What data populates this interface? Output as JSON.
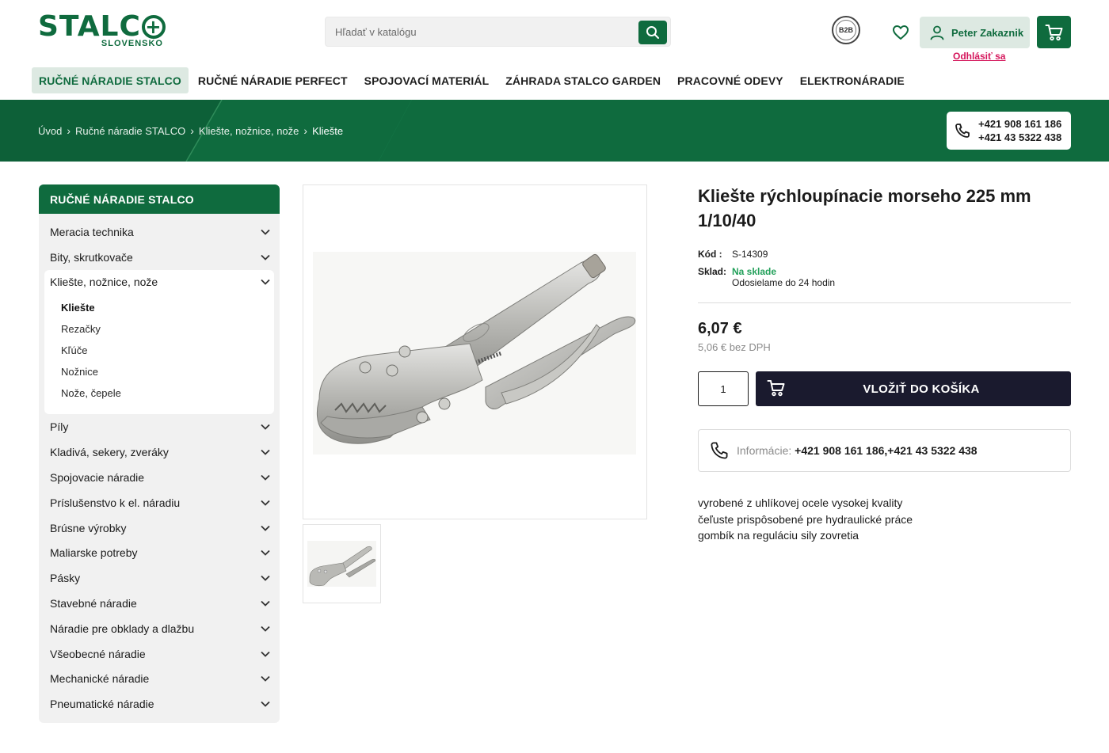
{
  "header": {
    "logo_text": "STALC",
    "logo_plus": "+",
    "logo_sub": "SLOVENSKO",
    "search_placeholder": "Hľadať v katalógu",
    "b2b_label": "B2B",
    "user_name": "Peter Zakaznik",
    "logout_label": "Odhlásiť sa"
  },
  "nav": [
    {
      "label": "RUČNÉ NÁRADIE STALCO",
      "active": true
    },
    {
      "label": "RUČNÉ NÁRADIE PERFECT",
      "active": false
    },
    {
      "label": "SPOJOVACÍ MATERIÁL",
      "active": false
    },
    {
      "label": "ZÁHRADA STALCO GARDEN",
      "active": false
    },
    {
      "label": "PRACOVNÉ ODEVY",
      "active": false
    },
    {
      "label": "ELEKTRONÁRADIE",
      "active": false
    }
  ],
  "breadcrumb": [
    "Úvod",
    "Ručné náradie STALCO",
    "Kliešte, nožnice, nože",
    "Kliešte"
  ],
  "contact_phones": [
    "+421 908 161 186",
    "+421 43 5322 438"
  ],
  "sidebar": {
    "title": "RUČNÉ NÁRADIE STALCO",
    "categories": [
      "Meracia technika",
      "Bity, skrutkovače",
      "Kliešte, nožnice, nože",
      "Píly",
      "Kladivá, sekery, zveráky",
      "Spojovacie náradie",
      "Príslušenstvo k el. náradiu",
      "Brúsne výrobky",
      "Maliarske potreby",
      "Pásky",
      "Stavebné náradie",
      "Náradie pre obklady a dlažbu",
      "Všeobecné náradie",
      "Mechanické náradie",
      "Pneumatické náradie"
    ],
    "open_category": "Kliešte, nožnice, nože",
    "subcategories": [
      "Kliešte",
      "Rezačky",
      "Kľúče",
      "Nožnice",
      "Nože, čepele"
    ],
    "active_subcategory": "Kliešte"
  },
  "product": {
    "title": "Kliešte rýchloupínacie morseho 225 mm 1/10/40",
    "code_label": "Kód :",
    "code": "S-14309",
    "stock_label": "Sklad:",
    "stock_status": "Na sklade",
    "shipping": "Odosielame do 24 hodin",
    "price": "6,07 €",
    "price_ex_vat": "5,06 € bez DPH",
    "quantity": "1",
    "add_to_cart": "VLOŽIŤ DO KOŠÍKA",
    "info_label": "Informácie:",
    "info_value": "+421 908 161 186,+421 43 5322 438",
    "description": [
      "vyrobené z uhlíkovej ocele vysokej kvality",
      "čeľuste prispôsobené pre hydraulické práce",
      "gombík na reguláciu sily zovretia"
    ]
  },
  "colors": {
    "brand_green": "#0f6b3e",
    "light_green": "#dde9e2",
    "stock_green": "#22a05a",
    "logout_pink": "#d4145a",
    "cart_button": "#1a1a2e"
  }
}
